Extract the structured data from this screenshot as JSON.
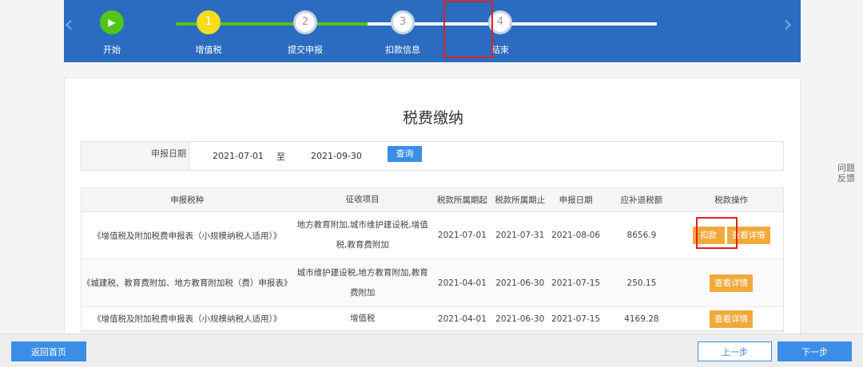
{
  "stepper": {
    "prev_icon": "‹",
    "next_icon": "›",
    "steps": [
      {
        "number": "▶",
        "label": "开始",
        "state": "done"
      },
      {
        "number": "1",
        "label": "增值税",
        "state": "done"
      },
      {
        "number": "2",
        "label": "提交申报",
        "state": "todo"
      },
      {
        "number": "3",
        "label": "扣款信息",
        "state": "current"
      },
      {
        "number": "4",
        "label": "结束",
        "state": "todo"
      }
    ]
  },
  "page": {
    "title": "税费缴纳"
  },
  "filter": {
    "label": "申报日期",
    "start": "2021-07-01",
    "separator": "至",
    "end": "2021-09-30",
    "query_label": "查询"
  },
  "table": {
    "headers": [
      "申报税种",
      "征收项目",
      "税款所属期起",
      "税款所属期止",
      "申报日期",
      "应补退税额",
      "税款操作"
    ],
    "rows": [
      {
        "tax_type": "《增值税及附加税费申报表（小规模纳税人适用）》",
        "items": "地方教育附加,城市维护建设税,增值税,教育费附加",
        "period_start": "2021-07-01",
        "period_end": "2021-07-31",
        "declare_date": "2021-08-06",
        "amount": "8656.9",
        "pay_label": "扣款",
        "detail_label": "查看详情"
      },
      {
        "tax_type": "《城建税、教育费附加、地方教育附加税（费）申报表》",
        "items": "城市维护建设税,地方教育附加,教育费附加",
        "period_start": "2021-04-01",
        "period_end": "2021-06-30",
        "declare_date": "2021-07-15",
        "amount": "250.15",
        "detail_label": "查看详情"
      },
      {
        "tax_type": "《增值税及附加税费申报表（小规模纳税人适用）》",
        "items": "增值税",
        "period_start": "2021-04-01",
        "period_end": "2021-06-30",
        "declare_date": "2021-07-15",
        "amount": "4169.28",
        "detail_label": "查看详情"
      }
    ]
  },
  "sidebar": {
    "feedback": "问题反馈"
  },
  "footer": {
    "home_label": "返回首页",
    "prev_label": "上一步",
    "next_label": "下一步"
  },
  "colors": {
    "banner": "#2b6cc0",
    "done": "#52c41a",
    "current": "#f5dd1e",
    "action": "#f2a93b",
    "primary": "#3a8ee6",
    "highlight": "#e02020"
  }
}
